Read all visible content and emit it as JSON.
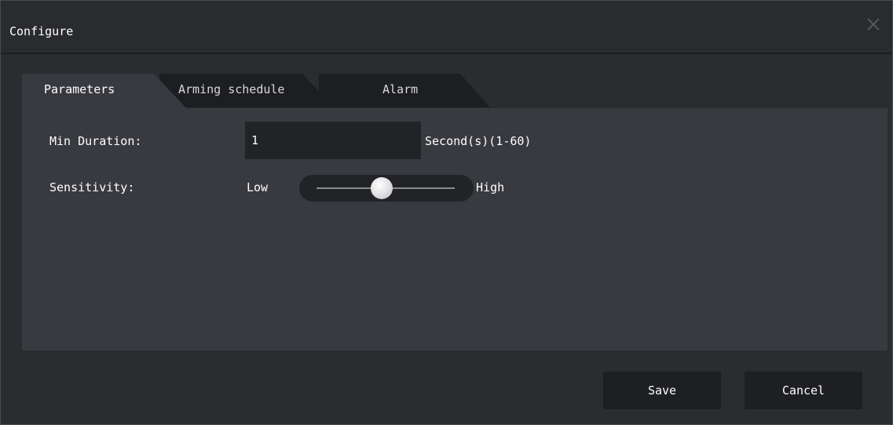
{
  "dialog": {
    "title": "Configure"
  },
  "tabs": [
    {
      "label": "Parameters",
      "active": true
    },
    {
      "label": "Arming schedule",
      "active": false
    },
    {
      "label": "Alarm",
      "active": false
    }
  ],
  "parameters": {
    "min_duration_label": "Min Duration:",
    "min_duration_value": "1",
    "min_duration_unit": "Second(s)(1-60)",
    "sensitivity_label": "Sensitivity:",
    "sensitivity_low": "Low",
    "sensitivity_high": "High",
    "sensitivity_level": 0.47
  },
  "buttons": {
    "save": "Save",
    "cancel": "Cancel"
  },
  "icons": {
    "close": "close-icon"
  },
  "colors": {
    "background": "#2b2c30",
    "panel": "#393a3f",
    "input": "#222326",
    "button": "#1e1f22",
    "text": "#ffffff"
  }
}
